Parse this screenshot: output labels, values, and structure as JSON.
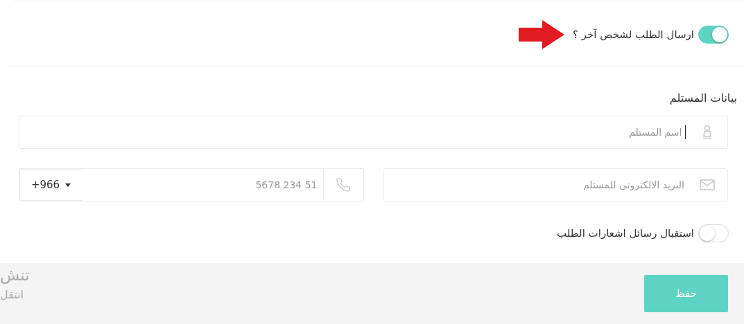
{
  "send_to_other": {
    "label": "ارسال الطلب لشخص آخر ؟",
    "on": true
  },
  "section_title": "بيانات المستلم",
  "name_field": {
    "placeholder": "اسم المستلم"
  },
  "email_field": {
    "placeholder": "البريد الالكترونى للمستلم"
  },
  "phone_field": {
    "placeholder": "5678 234 51",
    "country_code": "+966"
  },
  "notifications": {
    "label": "استقبال رسائل اشعارات الطلب",
    "on": false
  },
  "footer": {
    "texts": [
      "تنش",
      "انتقل"
    ],
    "save_button": "حفظ"
  }
}
